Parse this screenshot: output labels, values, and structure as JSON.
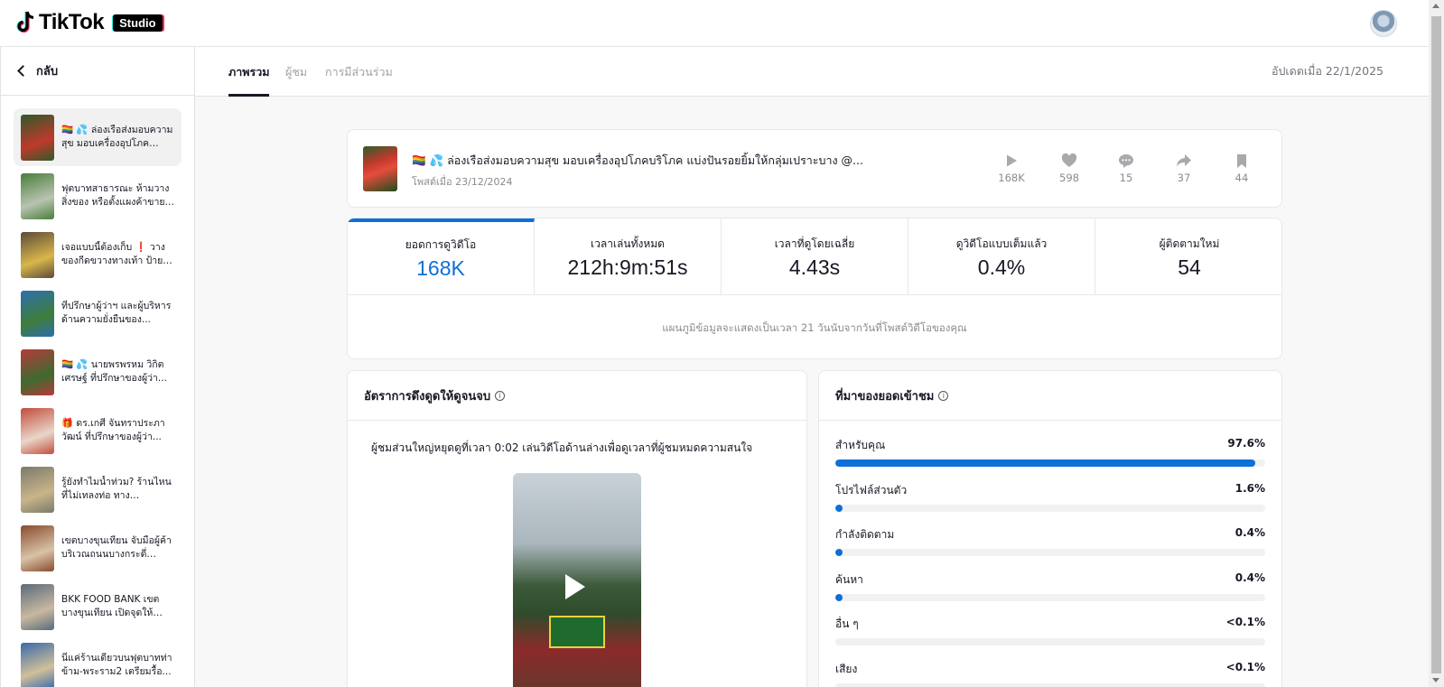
{
  "brand": {
    "logo_text": "TikTok",
    "badge": "Studio"
  },
  "sidebar": {
    "back_label": "กลับ",
    "videos": [
      {
        "title": "🏳️‍🌈 💦 ล่องเรือส่งมอบความสุข มอบเครื่องอุปโภคบริโภ...",
        "active": true,
        "colors": [
          "#2f5a2b",
          "#c0392b"
        ]
      },
      {
        "title": "ฟุตบาทสาธารณะ ห้ามวางสิ่งของ หรือตั้งแผงค้าขาย ...",
        "active": false,
        "colors": [
          "#4a7d3a",
          "#b8c4b0"
        ]
      },
      {
        "title": "เจอแบบนี้ต้องเก็บ ❗ วางของกีดขวางทางเท้า ป้ายไม่ได้...",
        "active": false,
        "colors": [
          "#5b4a3a",
          "#d9b64a"
        ]
      },
      {
        "title": "ที่ปรึกษาผู้ว่าฯ และผู้บริหารด้านความยั่งยืนของ...",
        "active": false,
        "colors": [
          "#2c6fb0",
          "#3f7d3a"
        ]
      },
      {
        "title": "🏳️‍🌈 💦 นายพรพรหม วิกิตเศรษฐ์ ที่ปรึกษาของผู้ว่า...",
        "active": false,
        "colors": [
          "#b83a3a",
          "#3d6b2f"
        ]
      },
      {
        "title": "🎁 ดร.เกศี จันทราประภาวัฒน์ ที่ปรึกษาของผู้ว่า...",
        "active": false,
        "colors": [
          "#c24c3c",
          "#e9d6c9"
        ]
      },
      {
        "title": "รู้ยังทำไมน้ำท่วม? ร้านไหนที่ไม่เทลงท่อ ทางสำนักงาน...",
        "active": false,
        "colors": [
          "#7a7a6a",
          "#c9b48a"
        ]
      },
      {
        "title": "เขตบางขุนเทียน จับมือผู้ค้าบริเวณถนนบางกระดี่ ร่วมใจ...",
        "active": false,
        "colors": [
          "#8a4b2b",
          "#d8c2a8"
        ]
      },
      {
        "title": "BKK FOOD BANK เขตบางขุนเทียน เปิดจุดให้บริก...",
        "active": false,
        "colors": [
          "#5a6a7a",
          "#c8b8a0"
        ]
      },
      {
        "title": "นี่แค่ร้านเดียวบนฟุตบาทท่าข้าม-พระราม2 เตรียมรื้อ...",
        "active": false,
        "colors": [
          "#3a6aa8",
          "#d0c09a"
        ]
      }
    ]
  },
  "tabs": [
    {
      "label": "ภาพรวม",
      "active": true
    },
    {
      "label": "ผู้ชม",
      "active": false
    },
    {
      "label": "การมีส่วนร่วม",
      "active": false
    }
  ],
  "updated_label": "อัปเดตเมื่อ 22/1/2025",
  "post": {
    "title": "🏳️‍🌈 💦 ล่องเรือส่งมอบความสุข มอบเครื่องอุปโภคบริโภค แบ่งปันรอยยิ้มให้กลุ่มเปราะบาง @...",
    "date": "โพสต์เมื่อ 23/12/2024",
    "stats": [
      {
        "icon": "play-icon",
        "value": "168K"
      },
      {
        "icon": "heart-icon",
        "value": "598"
      },
      {
        "icon": "comment-icon",
        "value": "15"
      },
      {
        "icon": "share-icon",
        "value": "37"
      },
      {
        "icon": "bookmark-icon",
        "value": "44"
      }
    ]
  },
  "metrics": [
    {
      "label": "ยอดการดูวิดีโอ",
      "value": "168K",
      "active": true
    },
    {
      "label": "เวลาเล่นทั้งหมด",
      "value": "212h:9m:51s",
      "active": false
    },
    {
      "label": "เวลาที่ดูโดยเฉลี่ย",
      "value": "4.43s",
      "active": false
    },
    {
      "label": "ดูวิดีโอแบบเต็มแล้ว",
      "value": "0.4%",
      "active": false
    },
    {
      "label": "ผู้ติดตามใหม่",
      "value": "54",
      "active": false
    }
  ],
  "metrics_note": "แผนภูมิข้อมูลจะแสดงเป็นเวลา 21 วันนับจากวันที่โพสต์วิดีโอของคุณ",
  "retention": {
    "title": "อัตราการดึงดูดให้ดูจนจบ",
    "description": "ผู้ชมส่วนใหญ่หยุดดูที่เวลา 0:02 เล่นวิดีโอด้านล่างเพื่อดูเวลาที่ผู้ชมหมดความสนใจ"
  },
  "sources": {
    "title": "ที่มาของยอดเข้าชม",
    "rows": [
      {
        "label": "สำหรับคุณ",
        "pct": "97.6%",
        "fraction": 0.976
      },
      {
        "label": "โปรไฟล์ส่วนตัว",
        "pct": "1.6%",
        "fraction": 0.016
      },
      {
        "label": "กำลังติดตาม",
        "pct": "0.4%",
        "fraction": 0.004
      },
      {
        "label": "ค้นหา",
        "pct": "0.4%",
        "fraction": 0.004
      },
      {
        "label": "อื่น ๆ",
        "pct": "<0.1%",
        "fraction": 0.0005
      },
      {
        "label": "เสียง",
        "pct": "<0.1%",
        "fraction": 0.0005
      }
    ]
  },
  "colors": {
    "accent": "#0e6fd8",
    "text": "#161823",
    "muted": "#8a8b91"
  }
}
